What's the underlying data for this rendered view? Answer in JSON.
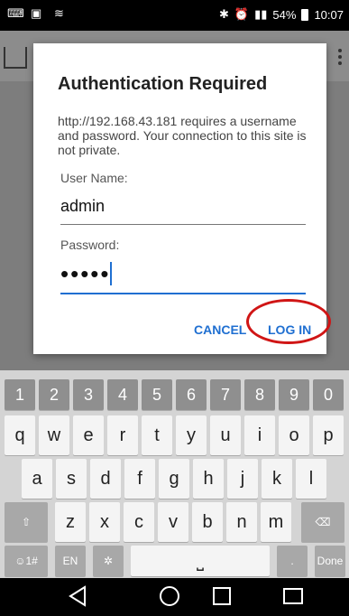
{
  "status": {
    "battery": "54%",
    "time": "10:07"
  },
  "dialog": {
    "title": "Authentication Required",
    "message": "http://192.168.43.181 requires a username and password. Your connection to this site is not private.",
    "username_label": "User Name:",
    "username_value": "admin",
    "password_label": "Password:",
    "password_mask": "•••••",
    "cancel_label": "CANCEL",
    "login_label": "LOG IN"
  },
  "keyboard": {
    "numbers": [
      "1",
      "2",
      "3",
      "4",
      "5",
      "6",
      "7",
      "8",
      "9",
      "0"
    ],
    "row1": [
      "q",
      "w",
      "e",
      "r",
      "t",
      "y",
      "u",
      "i",
      "o",
      "p"
    ],
    "row2": [
      "a",
      "s",
      "d",
      "f",
      "g",
      "h",
      "j",
      "k",
      "l"
    ],
    "row3": [
      "z",
      "x",
      "c",
      "v",
      "b",
      "n",
      "m"
    ],
    "sym_key": "☺1#",
    "lang_key": "EN",
    "done_key": "Done"
  }
}
